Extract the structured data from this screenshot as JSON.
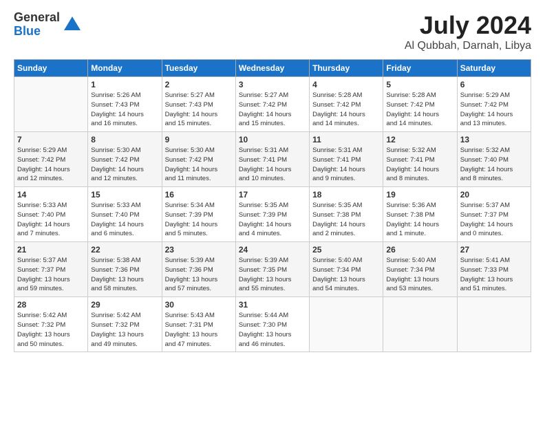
{
  "logo": {
    "general": "General",
    "blue": "Blue"
  },
  "title": "July 2024",
  "subtitle": "Al Qubbah, Darnah, Libya",
  "days_of_week": [
    "Sunday",
    "Monday",
    "Tuesday",
    "Wednesday",
    "Thursday",
    "Friday",
    "Saturday"
  ],
  "weeks": [
    [
      {
        "day": "",
        "info": ""
      },
      {
        "day": "1",
        "info": "Sunrise: 5:26 AM\nSunset: 7:43 PM\nDaylight: 14 hours\nand 16 minutes."
      },
      {
        "day": "2",
        "info": "Sunrise: 5:27 AM\nSunset: 7:43 PM\nDaylight: 14 hours\nand 15 minutes."
      },
      {
        "day": "3",
        "info": "Sunrise: 5:27 AM\nSunset: 7:42 PM\nDaylight: 14 hours\nand 15 minutes."
      },
      {
        "day": "4",
        "info": "Sunrise: 5:28 AM\nSunset: 7:42 PM\nDaylight: 14 hours\nand 14 minutes."
      },
      {
        "day": "5",
        "info": "Sunrise: 5:28 AM\nSunset: 7:42 PM\nDaylight: 14 hours\nand 14 minutes."
      },
      {
        "day": "6",
        "info": "Sunrise: 5:29 AM\nSunset: 7:42 PM\nDaylight: 14 hours\nand 13 minutes."
      }
    ],
    [
      {
        "day": "7",
        "info": "Sunrise: 5:29 AM\nSunset: 7:42 PM\nDaylight: 14 hours\nand 12 minutes."
      },
      {
        "day": "8",
        "info": "Sunrise: 5:30 AM\nSunset: 7:42 PM\nDaylight: 14 hours\nand 12 minutes."
      },
      {
        "day": "9",
        "info": "Sunrise: 5:30 AM\nSunset: 7:42 PM\nDaylight: 14 hours\nand 11 minutes."
      },
      {
        "day": "10",
        "info": "Sunrise: 5:31 AM\nSunset: 7:41 PM\nDaylight: 14 hours\nand 10 minutes."
      },
      {
        "day": "11",
        "info": "Sunrise: 5:31 AM\nSunset: 7:41 PM\nDaylight: 14 hours\nand 9 minutes."
      },
      {
        "day": "12",
        "info": "Sunrise: 5:32 AM\nSunset: 7:41 PM\nDaylight: 14 hours\nand 8 minutes."
      },
      {
        "day": "13",
        "info": "Sunrise: 5:32 AM\nSunset: 7:40 PM\nDaylight: 14 hours\nand 8 minutes."
      }
    ],
    [
      {
        "day": "14",
        "info": "Sunrise: 5:33 AM\nSunset: 7:40 PM\nDaylight: 14 hours\nand 7 minutes."
      },
      {
        "day": "15",
        "info": "Sunrise: 5:33 AM\nSunset: 7:40 PM\nDaylight: 14 hours\nand 6 minutes."
      },
      {
        "day": "16",
        "info": "Sunrise: 5:34 AM\nSunset: 7:39 PM\nDaylight: 14 hours\nand 5 minutes."
      },
      {
        "day": "17",
        "info": "Sunrise: 5:35 AM\nSunset: 7:39 PM\nDaylight: 14 hours\nand 4 minutes."
      },
      {
        "day": "18",
        "info": "Sunrise: 5:35 AM\nSunset: 7:38 PM\nDaylight: 14 hours\nand 2 minutes."
      },
      {
        "day": "19",
        "info": "Sunrise: 5:36 AM\nSunset: 7:38 PM\nDaylight: 14 hours\nand 1 minute."
      },
      {
        "day": "20",
        "info": "Sunrise: 5:37 AM\nSunset: 7:37 PM\nDaylight: 14 hours\nand 0 minutes."
      }
    ],
    [
      {
        "day": "21",
        "info": "Sunrise: 5:37 AM\nSunset: 7:37 PM\nDaylight: 13 hours\nand 59 minutes."
      },
      {
        "day": "22",
        "info": "Sunrise: 5:38 AM\nSunset: 7:36 PM\nDaylight: 13 hours\nand 58 minutes."
      },
      {
        "day": "23",
        "info": "Sunrise: 5:39 AM\nSunset: 7:36 PM\nDaylight: 13 hours\nand 57 minutes."
      },
      {
        "day": "24",
        "info": "Sunrise: 5:39 AM\nSunset: 7:35 PM\nDaylight: 13 hours\nand 55 minutes."
      },
      {
        "day": "25",
        "info": "Sunrise: 5:40 AM\nSunset: 7:34 PM\nDaylight: 13 hours\nand 54 minutes."
      },
      {
        "day": "26",
        "info": "Sunrise: 5:40 AM\nSunset: 7:34 PM\nDaylight: 13 hours\nand 53 minutes."
      },
      {
        "day": "27",
        "info": "Sunrise: 5:41 AM\nSunset: 7:33 PM\nDaylight: 13 hours\nand 51 minutes."
      }
    ],
    [
      {
        "day": "28",
        "info": "Sunrise: 5:42 AM\nSunset: 7:32 PM\nDaylight: 13 hours\nand 50 minutes."
      },
      {
        "day": "29",
        "info": "Sunrise: 5:42 AM\nSunset: 7:32 PM\nDaylight: 13 hours\nand 49 minutes."
      },
      {
        "day": "30",
        "info": "Sunrise: 5:43 AM\nSunset: 7:31 PM\nDaylight: 13 hours\nand 47 minutes."
      },
      {
        "day": "31",
        "info": "Sunrise: 5:44 AM\nSunset: 7:30 PM\nDaylight: 13 hours\nand 46 minutes."
      },
      {
        "day": "",
        "info": ""
      },
      {
        "day": "",
        "info": ""
      },
      {
        "day": "",
        "info": ""
      }
    ]
  ]
}
